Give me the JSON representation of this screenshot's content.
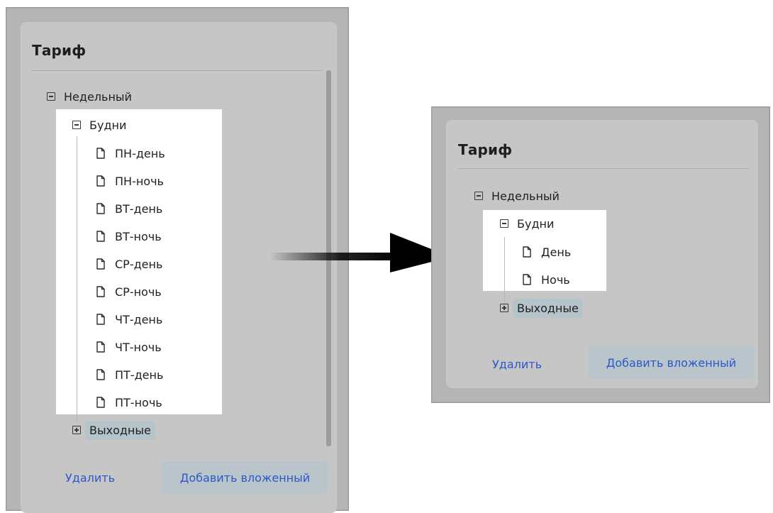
{
  "left_panel": {
    "title": "Тариф",
    "tree": {
      "root": "Недельный",
      "group": "Будни",
      "leaves": [
        "ПН-день",
        "ПН-ночь",
        "ВТ-день",
        "ВТ-ночь",
        "СР-день",
        "СР-ночь",
        "ЧТ-день",
        "ЧТ-ночь",
        "ПТ-день",
        "ПТ-ночь"
      ],
      "collapsed_group": "Выходные"
    },
    "buttons": {
      "delete": "Удалить",
      "add_child": "Добавить вложенный"
    }
  },
  "right_panel": {
    "title": "Тариф",
    "tree": {
      "root": "Недельный",
      "group": "Будни",
      "leaves": [
        "День",
        "Ночь"
      ],
      "collapsed_group": "Выходные"
    },
    "buttons": {
      "delete": "Удалить",
      "add_child": "Добавить вложенный"
    }
  },
  "colors": {
    "accent": "#2c58c8",
    "highlight_bg": "#ffffff",
    "selected_pill": "#b4c4ca",
    "panel_bg": "#c6c6c6"
  },
  "icons": {
    "expanded": "minus-square-icon",
    "collapsed": "plus-square-icon",
    "leaf": "document-icon",
    "transition": "right-arrow-icon"
  }
}
